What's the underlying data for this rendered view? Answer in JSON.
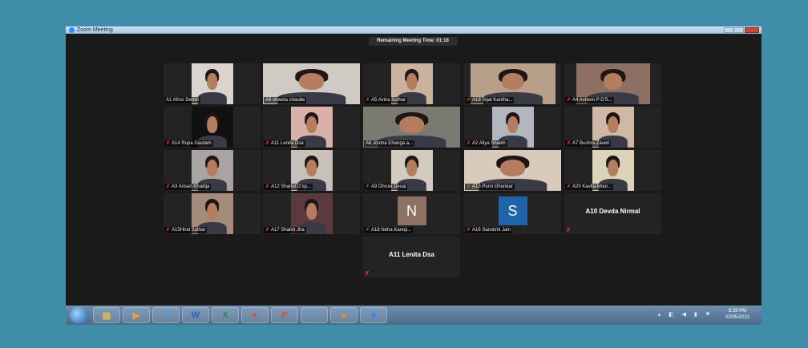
{
  "window": {
    "title": "Zoom Meeting"
  },
  "timer": "Remaining Meeting Time: 01:18",
  "participants": [
    {
      "name": "A1 Afroz Dehlvi",
      "muted": false,
      "video": true,
      "active": false,
      "bg": "#d9d4cd"
    },
    {
      "name": "A8 shweta chaube",
      "muted": false,
      "video": true,
      "active": true,
      "bg": "#cfcac4"
    },
    {
      "name": "A5 Avina Suthar",
      "muted": true,
      "video": true,
      "active": false,
      "bg": "#c9b39c"
    },
    {
      "name": "A19 Tejal Kantha...",
      "muted": true,
      "video": true,
      "active": false,
      "bg": "#b89f8a"
    },
    {
      "name": "A4 Ashwin P D'S...",
      "muted": true,
      "video": true,
      "active": false,
      "bg": "#8d6f63"
    },
    {
      "name": "A14 Rupa Gautam",
      "muted": true,
      "video": true,
      "active": false,
      "bg": "#111111"
    },
    {
      "name": "A11 Lenita Dsa",
      "muted": true,
      "video": true,
      "active": false,
      "bg": "#d9b1a9"
    },
    {
      "name": "A6 Jostna Ehanga a...",
      "muted": false,
      "video": true,
      "active": false,
      "bg": "#7b7a70"
    },
    {
      "name": "A2 Aliya Shaikh",
      "muted": true,
      "video": true,
      "active": false,
      "bg": "#b2b7bd"
    },
    {
      "name": "A7 Bushra Zaveri",
      "muted": true,
      "video": true,
      "active": false,
      "bg": "#cfb8a6"
    },
    {
      "name": "A3 Ansari Khadija",
      "muted": true,
      "video": true,
      "active": false,
      "bg": "#a9a3a4"
    },
    {
      "name": "A12 Sharlet D'sp...",
      "muted": true,
      "video": true,
      "active": false,
      "bg": "#c7c1b9"
    },
    {
      "name": "A9 Dhruvi Desai",
      "muted": true,
      "video": true,
      "active": false,
      "bg": "#d3cbbf"
    },
    {
      "name": "A13 Purvi Ghonkar",
      "muted": true,
      "video": true,
      "active": false,
      "bg": "#d9cbbb"
    },
    {
      "name": "A20 Kavita Mour...",
      "muted": true,
      "video": true,
      "active": false,
      "bg": "#ddd3b9"
    },
    {
      "name": "A15Hiral Suthar",
      "muted": true,
      "video": true,
      "active": false,
      "bg": "#a58b79"
    },
    {
      "name": "A17 Shalini Jha",
      "muted": true,
      "video": true,
      "active": false,
      "bg": "#5a3a3c"
    },
    {
      "name": "A18 Neha Kanoji...",
      "muted": true,
      "video": false,
      "initial": "N",
      "initial_bg": "#8b7265"
    },
    {
      "name": "A16 Sanskriti Jain",
      "muted": true,
      "video": false,
      "initial": "S",
      "initial_bg": "#1f63a8"
    },
    {
      "name": "A10 Devda Nirmal",
      "muted": true,
      "video": false,
      "name_only": true
    },
    {
      "name": "A11 Lenita Dsa",
      "muted": true,
      "video": false,
      "name_only": true
    }
  ],
  "taskbar": {
    "icons": [
      {
        "name": "explorer-icon",
        "glyph": "▤",
        "color": "#e8c15a"
      },
      {
        "name": "media-player-icon",
        "glyph": "▶",
        "color": "#f0a030"
      },
      {
        "name": "edge-icon",
        "glyph": "e",
        "color": "#33a2e8"
      },
      {
        "name": "word-icon",
        "glyph": "W",
        "color": "#2b5fb4"
      },
      {
        "name": "excel-icon",
        "glyph": "X",
        "color": "#1f8a46"
      },
      {
        "name": "chrome-icon",
        "glyph": "●",
        "color": "#e04a3a"
      },
      {
        "name": "powerpoint-icon",
        "glyph": "P",
        "color": "#d2542d"
      },
      {
        "name": "internet-explorer-icon",
        "glyph": "e",
        "color": "#3aa0e0"
      },
      {
        "name": "vlc-icon",
        "glyph": "▲",
        "color": "#f08c1a"
      },
      {
        "name": "zoom-icon",
        "glyph": "■",
        "color": "#2d8cff"
      }
    ],
    "time": "8:39 PM",
    "date": "02/05/2021"
  },
  "colors": {
    "active_speaker": "#c6e04a",
    "mute_icon": "#e33333"
  }
}
